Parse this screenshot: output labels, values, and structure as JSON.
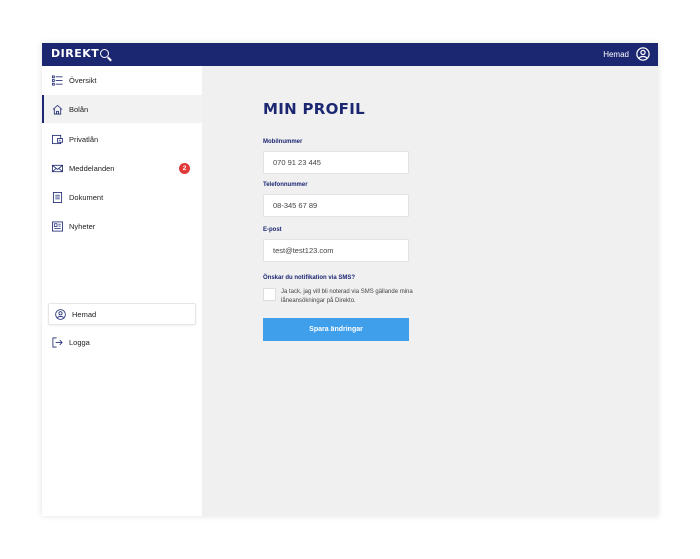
{
  "header": {
    "logo": "DIREKT",
    "user_name": "Hemad"
  },
  "sidebar": {
    "items": [
      {
        "label": "Översikt",
        "icon": "list-icon"
      },
      {
        "label": "Bolån",
        "icon": "home-icon",
        "active": true
      },
      {
        "label": "Privatlån",
        "icon": "card-icon"
      },
      {
        "label": "Meddelanden",
        "icon": "envelope-icon",
        "badge": "2"
      },
      {
        "label": "Dokument",
        "icon": "document-icon"
      },
      {
        "label": "Nyheter",
        "icon": "newspaper-icon"
      }
    ],
    "user": {
      "label": "Hemad",
      "icon": "user-icon"
    },
    "logout": {
      "label": "Logga",
      "icon": "logout-icon"
    }
  },
  "profile": {
    "title": "MIN PROFIL",
    "fields": [
      {
        "label": "Mobilnummer",
        "value": "070 91 23 445"
      },
      {
        "label": "Telefonnummer",
        "value": "08-345 67 89"
      },
      {
        "label": "E-post",
        "value": "test@test123.com"
      }
    ],
    "sms_question": "Önskar du notifikation via SMS?",
    "sms_consent": "Ja tack, jag vill bli noterad via SMS gällande mina låneansökningar på Direkto.",
    "save_label": "Spara ändringar"
  },
  "colors": {
    "brand": "#1c2772",
    "button": "#3f9fea",
    "badge": "#e23a3a",
    "background": "#f0f0f1"
  }
}
